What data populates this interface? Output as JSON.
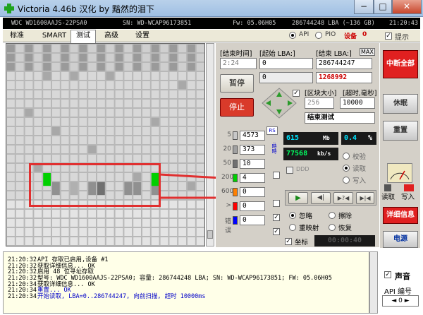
{
  "window": {
    "title": "Victoria 4.46b 汉化 by 黯然的泪下",
    "minimize": "−",
    "maximize": "□",
    "close": "✕"
  },
  "infobar": {
    "model": "WDC WD1600AAJS-22PSA0",
    "serial": "SN: WD-WCAP96173851",
    "firmware": "Fw: 05.06H05",
    "lba": "286744248 LBA (~136 GB)",
    "clock": "21:20:43"
  },
  "tabs": [
    {
      "label": "标准"
    },
    {
      "label": "SMART"
    },
    {
      "label": "测试"
    },
    {
      "label": "高级"
    },
    {
      "label": "设置"
    }
  ],
  "api_bar": {
    "api": "API",
    "pio": "PIO",
    "device_label": "设备",
    "device_num": "0",
    "hint_label": "提示"
  },
  "test": {
    "end_time_label": "[结束时间]",
    "start_lba_label": "[起始 LBA:]",
    "end_lba_label": "[结束 LBA:]",
    "max_label": "MAX",
    "time_value": "2:24",
    "start_lba": "0",
    "end_lba": "286744247",
    "current_lba": "1268992",
    "start_lba2": "0",
    "pause": "暂停",
    "stop": "停止",
    "block_size_label": "[区块大小]",
    "timeout_label": "[超时,毫秒]",
    "block_size": "256",
    "timeout": "10000",
    "end_test": "结束测试"
  },
  "legend": [
    {
      "ms": "5",
      "count": "4573",
      "color": "#c8c8c8"
    },
    {
      "ms": "20",
      "count": "373",
      "color": "#a0a0a0"
    },
    {
      "ms": "50",
      "count": "10",
      "color": "#707070"
    },
    {
      "ms": "200",
      "count": "4",
      "color": "#00d000"
    },
    {
      "ms": "600",
      "count": "0",
      "color": "#ff8000"
    },
    {
      "ms": ">",
      "count": "0",
      "color": "#ff0000"
    },
    {
      "ms": "错误",
      "count": "0",
      "color": "#0000ff"
    }
  ],
  "rs": "RS",
  "stats": {
    "speed": "615",
    "speed_unit": "Mb",
    "percent": "0.4",
    "percent_unit": "%",
    "rate": "77568",
    "rate_unit": "kb/s",
    "verify": "校验",
    "read": "读取",
    "write": "写入",
    "ddd": "DDD"
  },
  "playback": {
    "play": "▶",
    "back": "◀|",
    "skip": "▶?◀",
    "end": "▶|◀"
  },
  "actions": {
    "ignore": "忽略",
    "erase": "擦除",
    "remap": "重映射",
    "restore": "恢复"
  },
  "coords": {
    "label": "坐标",
    "value": "00:00:40"
  },
  "right": {
    "break_all": "中断全部",
    "sleep": "休眠",
    "reset": "重置",
    "read": "读取",
    "write": "写入",
    "details": "详细信息",
    "power": "电源",
    "sound": "声音",
    "api_num": "API 编号"
  },
  "log": [
    {
      "time": "21:20:32",
      "msg": "API 存取已启用,设备 #1",
      "blue": false
    },
    {
      "time": "21:20:32",
      "msg": "获取详细信息... OK",
      "blue": false
    },
    {
      "time": "21:20:32",
      "msg": "启用 48 位寻址存取",
      "blue": false
    },
    {
      "time": "21:20:32",
      "msg": "型号:  WDC WD1600AAJS-22PSA0;        容量: 286744248 LBA; SN: WD-WCAP96173851; FW: 05.06H05",
      "blue": false
    },
    {
      "time": "21:20:34",
      "msg": "获取详细信息... OK",
      "blue": false
    },
    {
      "time": "21:20:34",
      "msg": "重置... OK",
      "blue": true
    },
    {
      "time": "21:20:34",
      "msg": "开始读取, LBA=0..286744247, 向前扫描, 超时 10000ms",
      "blue": true
    }
  ]
}
